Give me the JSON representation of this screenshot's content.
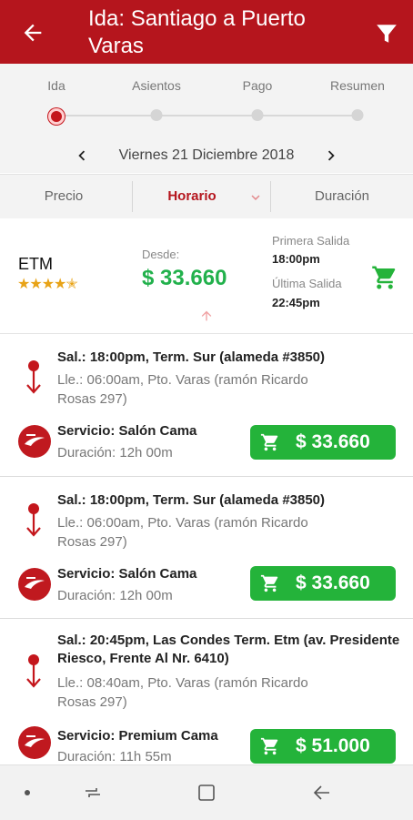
{
  "header": {
    "title": "Ida: Santiago a Puerto Varas",
    "back_icon": "arrow-left-icon",
    "filter_icon": "filter-icon"
  },
  "steps": [
    {
      "label": "Ida",
      "active": true
    },
    {
      "label": "Asientos",
      "active": false
    },
    {
      "label": "Pago",
      "active": false
    },
    {
      "label": "Resumen",
      "active": false
    }
  ],
  "date": "Viernes 21 Diciembre 2018",
  "sort": {
    "precio": "Precio",
    "horario": "Horario",
    "duracion": "Duración"
  },
  "summary": {
    "operator": "ETM",
    "rating_stars": "★★★★✭",
    "rating_value": 4.5,
    "desde_label": "Desde:",
    "price": "$ 33.660",
    "primera_label": "Primera Salida",
    "primera_time": "18:00pm",
    "ultima_label": "Última Salida",
    "ultima_time": "22:45pm"
  },
  "trips": [
    {
      "salida": "Sal.: 18:00pm, Term. Sur (alameda #3850)",
      "llegada": "Lle.: 06:00am, Pto. Varas (ramón Ricardo Rosas 297)",
      "servicio": "Servicio: Salón Cama",
      "duracion": "Duración: 12h 00m",
      "price": "$ 33.660"
    },
    {
      "salida": "Sal.: 18:00pm, Term. Sur (alameda #3850)",
      "llegada": "Lle.: 06:00am, Pto. Varas (ramón Ricardo Rosas 297)",
      "servicio": "Servicio: Salón Cama",
      "duracion": "Duración: 12h 00m",
      "price": "$ 33.660"
    },
    {
      "salida": "Sal.: 20:45pm, Las Condes Term. Etm (av. Presidente Riesco, Frente Al Nr. 6410)",
      "llegada": "Lle.: 08:40am, Pto. Varas (ramón Ricardo Rosas 297)",
      "servicio": "Servicio: Premium Cama",
      "duracion": "Duración: 11h 55m",
      "price": "$ 51.000"
    }
  ],
  "colors": {
    "brand_red": "#b5151d",
    "price_green": "#22b14c",
    "button_green": "#24b33a"
  }
}
